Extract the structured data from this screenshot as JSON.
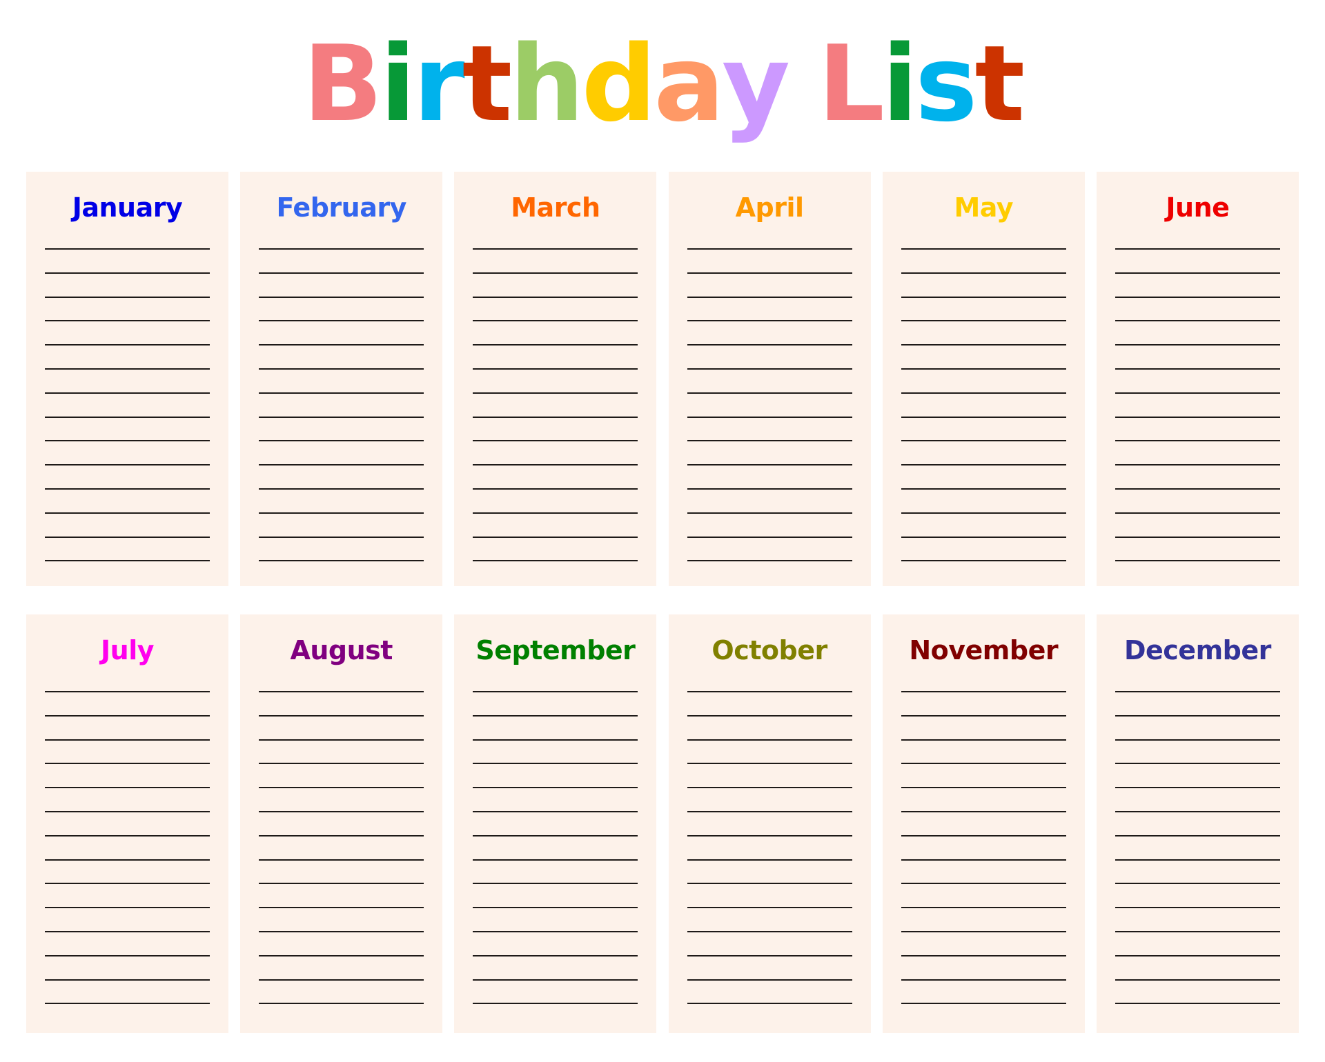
{
  "title": {
    "text": "Birthday List",
    "letters": [
      {
        "char": "B",
        "color": "#f47c80"
      },
      {
        "char": "i",
        "color": "#079937"
      },
      {
        "char": "r",
        "color": "#00b2ec"
      },
      {
        "char": "t",
        "color": "#cc3300"
      },
      {
        "char": "h",
        "color": "#9ccc66"
      },
      {
        "char": "d",
        "color": "#ffcc00"
      },
      {
        "char": "a",
        "color": "#ff9966"
      },
      {
        "char": "y",
        "color": "#cc99ff"
      },
      {
        "char": " ",
        "color": ""
      },
      {
        "char": "L",
        "color": "#f47c80"
      },
      {
        "char": "i",
        "color": "#079937"
      },
      {
        "char": "s",
        "color": "#00b2ec"
      },
      {
        "char": "t",
        "color": "#cc3300"
      }
    ]
  },
  "card_background": "#fdf2ea",
  "line_color": "#1e1a18",
  "lines_per_month": 14,
  "months": [
    {
      "name": "January",
      "color": "#0000e6"
    },
    {
      "name": "February",
      "color": "#3366ee"
    },
    {
      "name": "March",
      "color": "#ff6600"
    },
    {
      "name": "April",
      "color": "#ff9900"
    },
    {
      "name": "May",
      "color": "#ffcc00"
    },
    {
      "name": "June",
      "color": "#ee0000"
    },
    {
      "name": "July",
      "color": "#ff00ee"
    },
    {
      "name": "August",
      "color": "#800080"
    },
    {
      "name": "September",
      "color": "#008000"
    },
    {
      "name": "October",
      "color": "#808000"
    },
    {
      "name": "November",
      "color": "#800000"
    },
    {
      "name": "December",
      "color": "#333399"
    }
  ]
}
